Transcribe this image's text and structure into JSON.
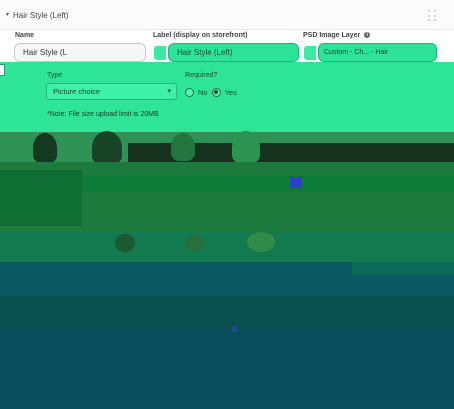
{
  "section": {
    "title": "Hair Style (Left)"
  },
  "fields": {
    "name_label": "Name",
    "name_value": "Hair Style (L",
    "display_label": "Label (display on storefront)",
    "display_value": "Hair Style (Left)",
    "psd_label": "PSD Image Layer",
    "psd_value": "Custom - Ch... - Hair",
    "info_glyph": "i"
  },
  "options": {
    "type_label": "Type",
    "type_value": "Picture choice",
    "required_label": "Required?",
    "required_no": "No",
    "required_yes": "Yes",
    "required_selected": "Yes",
    "note": "*Note: File size upload limit is 20MB"
  },
  "icons": {
    "collapse": "caret-down-icon",
    "drag": "drag-handle-icon",
    "select_caret": "chevron-down-icon"
  },
  "colors": {
    "accent": "#2de39a",
    "panel": "#2ee597"
  }
}
